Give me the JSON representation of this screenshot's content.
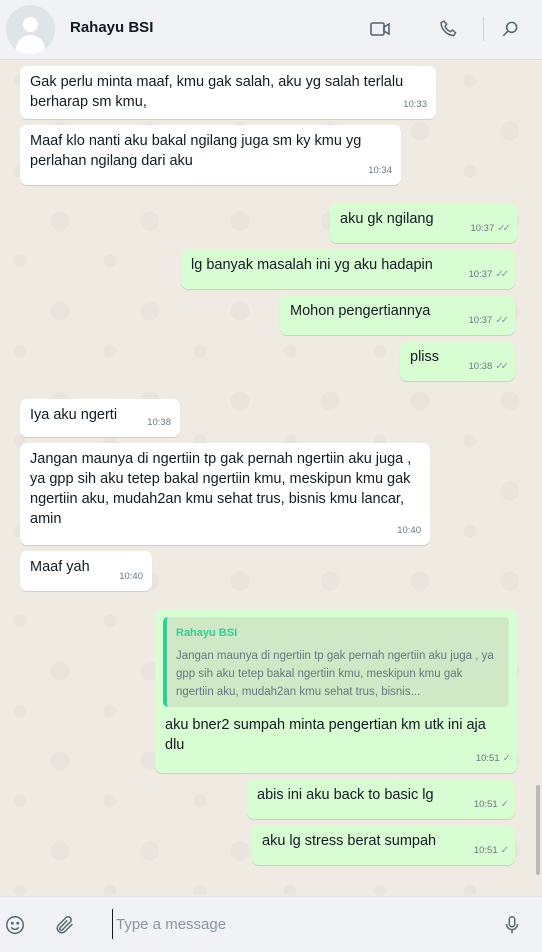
{
  "header": {
    "contact_name": "Rahayu BSI"
  },
  "messages": [
    {
      "dir": "in",
      "text": "Gak perlu minta maaf, kmu gak salah, aku yg salah terlalu berharap sm kmu,",
      "time": "10:33"
    },
    {
      "dir": "in",
      "text": "Maaf klo nanti aku bakal ngilang juga sm ky kmu yg perlahan ngilang dari aku",
      "time": "10:34"
    },
    {
      "dir": "out",
      "text": "aku gk ngilang",
      "time": "10:37",
      "tick": "✓✓"
    },
    {
      "dir": "out",
      "text": "lg banyak masalah ini yg aku hadapin",
      "time": "10:37",
      "tick": "✓✓"
    },
    {
      "dir": "out",
      "text": "Mohon pengertiannya",
      "time": "10:37",
      "tick": "✓✓"
    },
    {
      "dir": "out",
      "text": "pliss",
      "time": "10:38",
      "tick": "✓✓"
    },
    {
      "dir": "in",
      "text": "Iya aku ngerti",
      "time": "10:38"
    },
    {
      "dir": "in",
      "text": "Jangan maunya di ngertiin tp gak pernah ngertiin aku juga , ya gpp sih aku tetep bakal ngertiin kmu, meskipun kmu gak ngertiin aku, mudah2an kmu sehat trus, bisnis kmu lancar, amin",
      "time": "10:40"
    },
    {
      "dir": "in",
      "text": "Maaf yah",
      "time": "10:40"
    },
    {
      "dir": "out",
      "quote_name": "Rahayu BSI",
      "quote_text": "Jangan maunya di ngertiin tp gak pernah ngertiin aku juga , ya gpp sih aku tetep bakal ngertiin kmu, meskipun kmu gak ngertiin aku, mudah2an kmu sehat trus, bisnis...",
      "text": "aku bner2 sumpah minta pengertian km utk ini aja dlu",
      "time": "10:51",
      "tick": "✓"
    },
    {
      "dir": "out",
      "text": "abis ini aku back to basic lg",
      "time": "10:51",
      "tick": "✓"
    },
    {
      "dir": "out",
      "text": "aku lg stress berat sumpah",
      "time": "10:51",
      "tick": "✓"
    }
  ],
  "composer": {
    "placeholder": "Type a message"
  },
  "icons": [
    "video-call-icon",
    "voice-call-icon",
    "search-icon",
    "emoji-icon",
    "attach-icon",
    "microphone-icon"
  ]
}
